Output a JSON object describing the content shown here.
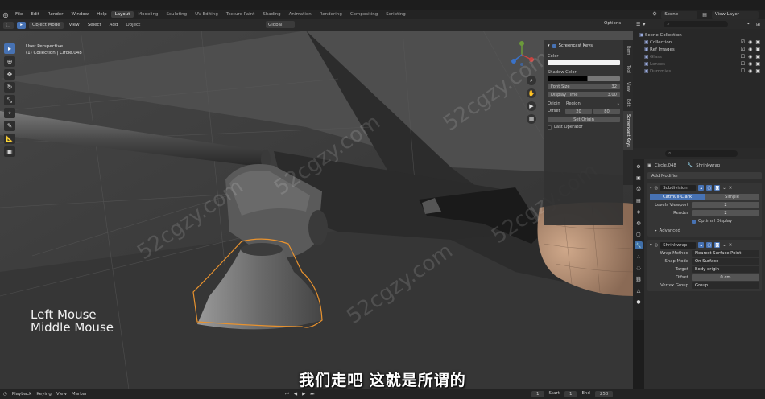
{
  "topbar": {
    "menus": [
      "File",
      "Edit",
      "Render",
      "Window",
      "Help"
    ],
    "workspaces": [
      "Layout",
      "Modeling",
      "Sculpting",
      "UV Editing",
      "Texture Paint",
      "Shading",
      "Animation",
      "Rendering",
      "Compositing",
      "Scripting"
    ],
    "active_workspace": "Layout",
    "scene": "Scene",
    "view_layer": "View Layer"
  },
  "vp_header": {
    "mode": "Object Mode",
    "menus": [
      "View",
      "Select",
      "Add",
      "Object"
    ],
    "orientation": "Global",
    "options": "Options"
  },
  "viewport": {
    "perspective": "User Perspective",
    "collection_info": "(1) Collection | Circle.048"
  },
  "screencast": {
    "title": "Screencast Keys",
    "color_label": "Color",
    "shadow_label": "Shadow Color",
    "font_size_label": "Font Size",
    "font_size": "32",
    "display_time_label": "Display Time",
    "display_time": "3.00",
    "origin_label": "Origin",
    "origin_value": "Region",
    "offset_label": "Offset",
    "offset_x": "20",
    "offset_y": "80",
    "set_origin": "Set Origin",
    "last_operator": "Last Operator",
    "color_value": "#f2f2f2",
    "shadow_value": "#000000"
  },
  "side_tabs": [
    "Item",
    "Tool",
    "View",
    "Edit",
    "Screencast Keys"
  ],
  "overlay_keys": [
    "Left Mouse",
    "Middle Mouse"
  ],
  "subtitle": "我们走吧 这就是所谓的",
  "watermark": "52cgzy.com",
  "outliner": {
    "items": [
      {
        "label": "Scene Collection",
        "icon": "collection-icon"
      },
      {
        "label": "Collection",
        "icon": "collection-icon"
      },
      {
        "label": "Ref Images",
        "icon": "collection-icon"
      },
      {
        "label": "Glass",
        "icon": "collection-icon"
      },
      {
        "label": "Lenses",
        "icon": "collection-icon"
      },
      {
        "label": "Dummies",
        "icon": "collection-icon"
      }
    ]
  },
  "properties": {
    "object_name": "Circle.048",
    "modifier_ref": "Shrinkwrap",
    "add_modifier": "Add Modifier",
    "subdivision": {
      "name": "Subdivision",
      "mode_a": "Catmull-Clark",
      "mode_b": "Simple",
      "levels_viewport_label": "Levels Viewport",
      "levels_viewport": "2",
      "render_label": "Render",
      "render": "2",
      "optimal_display": "Optimal Display",
      "advanced": "Advanced"
    },
    "shrinkwrap": {
      "name": "Shrinkwrap",
      "wrap_method_label": "Wrap Method",
      "wrap_method": "Nearest Surface Point",
      "snap_mode_label": "Snap Mode",
      "snap_mode": "On Surface",
      "target_label": "Target",
      "target": "Body origin",
      "offset_label": "Offset",
      "offset": "0 cm",
      "vertex_group_label": "Vertex Group",
      "vertex_group": "Group"
    }
  },
  "timeline": {
    "menus": [
      "Playback",
      "Keying",
      "View",
      "Marker"
    ],
    "current_frame": "1",
    "start_label": "Start",
    "start": "1",
    "end_label": "End",
    "end": "250"
  }
}
